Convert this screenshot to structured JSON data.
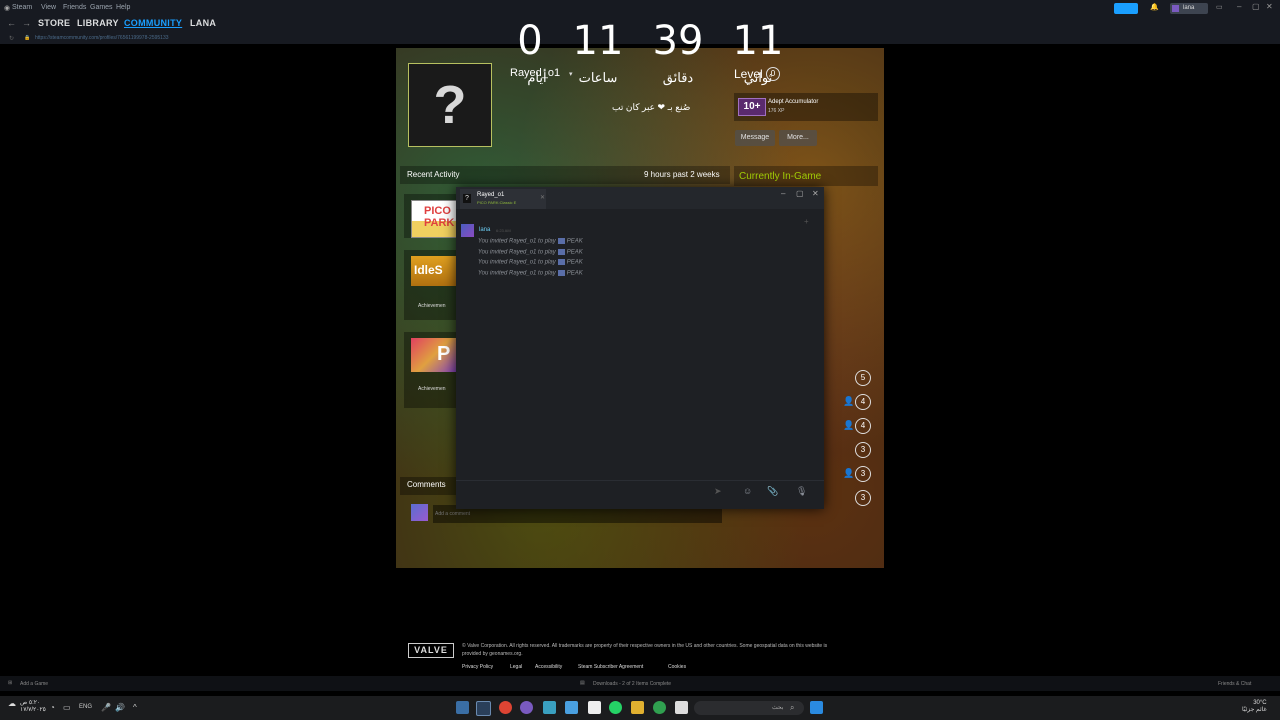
{
  "menubar": {
    "items": [
      "Steam",
      "View",
      "Friends",
      "Games",
      "Help"
    ]
  },
  "nav": {
    "store": "STORE",
    "library": "LIBRARY",
    "community": "COMMUNITY",
    "user": "LANA",
    "url": "https://steamcommunity.com/profiles/76561199978-2595133"
  },
  "topright": {
    "user": "lana"
  },
  "timer": [
    {
      "num": "0",
      "label": "أيام"
    },
    {
      "num": "11",
      "label": "ساعات"
    },
    {
      "num": "39",
      "label": "دقائق"
    },
    {
      "num": "11",
      "label": "ثواني"
    }
  ],
  "profile": {
    "username": "Rayed_o1",
    "subtitle": "صُنع بـ ❤ عبر كان تب",
    "level_label": "Level",
    "level_value": "0",
    "badge_number": "10+",
    "badge_name": "Adept Accumulator",
    "badge_xp": "176 XP",
    "message_btn": "Message",
    "more_btn": "More...",
    "recent_title": "Recent Activity",
    "recent_hours": "9 hours past 2 weeks",
    "ingame_title": "Currently In-Game",
    "achievements_label": "Achievemen",
    "comments_title": "Comments",
    "comment_placeholder": "Add a comment"
  },
  "games": [
    {
      "name": "PICO PARK"
    },
    {
      "name": "IdleS"
    },
    {
      "name": "P"
    }
  ],
  "counts": [
    "5",
    "4",
    "4",
    "3",
    "3",
    "3"
  ],
  "chat": {
    "tab_name": "Rayed_o1",
    "tab_game": "PICO PARK:Classic E",
    "sender": "lana",
    "time": "6:23 AM",
    "messages": [
      {
        "prefix": "You invited Rayed_o1 to play",
        "game": "PEAK"
      },
      {
        "prefix": "You invited Rayed_o1 to play",
        "game": "PEAK"
      },
      {
        "prefix": "You invited Rayed_o1 to play",
        "game": "PEAK"
      },
      {
        "prefix": "You invited Rayed_o1 to play",
        "game": "PEAK"
      }
    ]
  },
  "footer": {
    "valve": "VALVE",
    "text": "© Valve Corporation. All rights reserved. All trademarks are property of their respective owners in the US and other countries. Some geospatial data on this website is provided by geonames.org.",
    "links": [
      "Privacy Policy",
      "Legal",
      "Accessibility",
      "Steam Subscriber Agreement",
      "Cookies"
    ]
  },
  "statusbar": {
    "add_game": "Add a Game",
    "downloads": "Downloads - 2 of 2 Items Complete",
    "friends": "Friends & Chat"
  },
  "taskbar": {
    "search": "بحث",
    "lang": "ENG",
    "weather": "30°C",
    "weather_sub": "غائم جزئيًا",
    "time": "٥:٢٠ ص",
    "date": "١٧/٧/٢٠٢٥"
  }
}
